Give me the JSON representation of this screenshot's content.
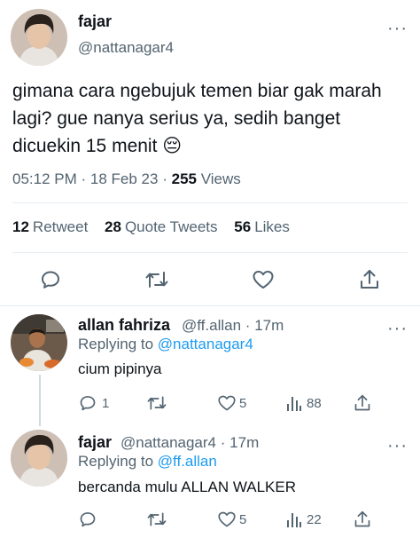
{
  "main_tweet": {
    "author_name": "fajar",
    "author_handle": "@nattanagar4",
    "text": "gimana cara ngebujuk temen biar gak marah lagi? gue nanya serius ya, sedih banget dicuekin 15 menit 😔",
    "time": "05:12 PM",
    "date": "18 Feb 23",
    "views_count": "255",
    "views_label": "Views",
    "retweet_count": "12",
    "retweet_label": "Retweet",
    "quote_count": "28",
    "quote_label": "Quote Tweets",
    "likes_count": "56",
    "likes_label": "Likes",
    "actions": [
      "reply-icon",
      "retweet-icon",
      "like-icon",
      "share-icon"
    ]
  },
  "replies": [
    {
      "author_name": "allan fahriza",
      "author_handle": "@ff.allan",
      "age": "17m",
      "replying_prefix": "Replying to",
      "replying_to": "@nattanagar4",
      "text": "cium pipinya",
      "reply_count": "1",
      "retweet_count": "",
      "like_count": "5",
      "views_count": "88"
    },
    {
      "author_name": "fajar",
      "author_handle": "@nattanagar4",
      "age": "17m",
      "replying_prefix": "Replying to",
      "replying_to": "@ff.allan",
      "text": "bercanda mulu ALLAN WALKER",
      "reply_count": "",
      "retweet_count": "",
      "like_count": "5",
      "views_count": "22"
    }
  ],
  "separator": "·",
  "more_menu": "···",
  "colors": {
    "text": "#0f1419",
    "secondary": "#536471",
    "link": "#1d9bf0",
    "divider": "#e6ecf0"
  }
}
